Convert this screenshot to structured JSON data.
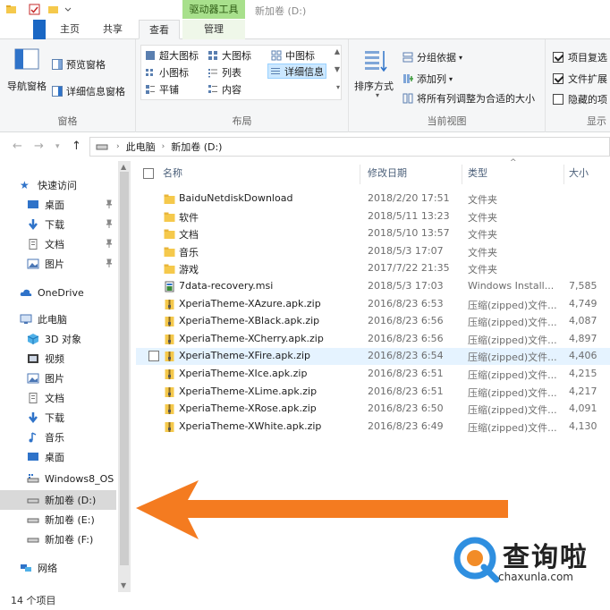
{
  "window": {
    "title": "新加卷 (D:)",
    "context_tab_group": "驱动器工具"
  },
  "tabs": [
    {
      "label": "主页"
    },
    {
      "label": "共享"
    },
    {
      "label": "查看"
    },
    {
      "label": "管理"
    }
  ],
  "ribbon": {
    "pane_group": {
      "label": "窗格",
      "nav_pane": "导航窗格",
      "preview_pane": "预览窗格",
      "details_pane": "详细信息窗格"
    },
    "layout_group": {
      "label": "布局",
      "items": [
        "超大图标",
        "大图标",
        "中图标",
        "小图标",
        "列表",
        "详细信息",
        "平铺",
        "内容"
      ]
    },
    "current_view_group": {
      "label": "当前视图",
      "sort_by": "排序方式",
      "group_by": "分组依据",
      "add_column": "添加列",
      "fit_columns": "将所有列调整为合适的大小"
    },
    "show_group": {
      "label": "显示",
      "item_checkboxes": "项目复选",
      "file_extensions": "文件扩展",
      "hidden_items": "隐藏的项"
    }
  },
  "address": {
    "crumbs": [
      "此电脑",
      "新加卷 (D:)"
    ]
  },
  "nav": {
    "quick_access": "快速访问",
    "quick_items": [
      "桌面",
      "下载",
      "文档",
      "图片"
    ],
    "onedrive": "OneDrive",
    "this_pc": "此电脑",
    "pc_items": [
      "3D 对象",
      "视频",
      "图片",
      "文档",
      "下载",
      "音乐",
      "桌面"
    ],
    "drives": [
      "Windows8_OS",
      "新加卷 (D:)",
      "新加卷 (E:)",
      "新加卷 (F:)"
    ],
    "network": "网络"
  },
  "columns": {
    "name": "名称",
    "date": "修改日期",
    "type": "类型",
    "size": "大小"
  },
  "files": [
    {
      "name": "BaiduNetdiskDownload",
      "date": "2018/2/20 17:51",
      "type": "文件夹",
      "size": "",
      "kind": "folder"
    },
    {
      "name": "软件",
      "date": "2018/5/11 13:23",
      "type": "文件夹",
      "size": "",
      "kind": "folder"
    },
    {
      "name": "文档",
      "date": "2018/5/10 13:57",
      "type": "文件夹",
      "size": "",
      "kind": "folder"
    },
    {
      "name": "音乐",
      "date": "2018/5/3 17:07",
      "type": "文件夹",
      "size": "",
      "kind": "folder"
    },
    {
      "name": "游戏",
      "date": "2017/7/22 21:35",
      "type": "文件夹",
      "size": "",
      "kind": "folder"
    },
    {
      "name": "7data-recovery.msi",
      "date": "2018/5/3 17:03",
      "type": "Windows Install...",
      "size": "7,585",
      "kind": "msi"
    },
    {
      "name": "XperiaTheme-XAzure.apk.zip",
      "date": "2016/8/23 6:53",
      "type": "压缩(zipped)文件...",
      "size": "4,749",
      "kind": "zip"
    },
    {
      "name": "XperiaTheme-XBlack.apk.zip",
      "date": "2016/8/23 6:56",
      "type": "压缩(zipped)文件...",
      "size": "4,087",
      "kind": "zip"
    },
    {
      "name": "XperiaTheme-XCherry.apk.zip",
      "date": "2016/8/23 6:56",
      "type": "压缩(zipped)文件...",
      "size": "4,897",
      "kind": "zip"
    },
    {
      "name": "XperiaTheme-XFire.apk.zip",
      "date": "2016/8/23 6:54",
      "type": "压缩(zipped)文件...",
      "size": "4,406",
      "kind": "zip"
    },
    {
      "name": "XperiaTheme-XIce.apk.zip",
      "date": "2016/8/23 6:51",
      "type": "压缩(zipped)文件...",
      "size": "4,215",
      "kind": "zip"
    },
    {
      "name": "XperiaTheme-XLime.apk.zip",
      "date": "2016/8/23 6:51",
      "type": "压缩(zipped)文件...",
      "size": "4,217",
      "kind": "zip"
    },
    {
      "name": "XperiaTheme-XRose.apk.zip",
      "date": "2016/8/23 6:50",
      "type": "压缩(zipped)文件...",
      "size": "4,091",
      "kind": "zip"
    },
    {
      "name": "XperiaTheme-XWhite.apk.zip",
      "date": "2016/8/23 6:49",
      "type": "压缩(zipped)文件...",
      "size": "4,130",
      "kind": "zip"
    }
  ],
  "status": {
    "item_count": "14 个项目"
  },
  "watermark": {
    "text": "查询啦",
    "domain": "chaxunla.com"
  },
  "colors": {
    "accent": "#1a67c4",
    "context_tab": "#a8e08c",
    "arrow": "#f47b20",
    "selection": "#cce8ff",
    "folder": "#f5c94c"
  }
}
